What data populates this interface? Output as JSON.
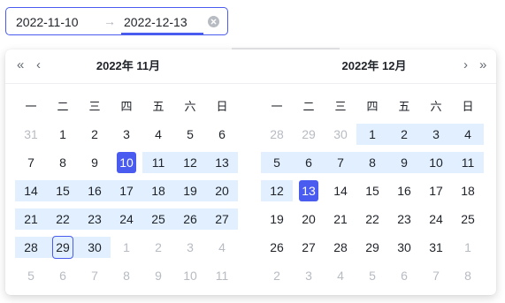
{
  "range_input": {
    "start": "2022-11-10",
    "separator": "→",
    "end": "2022-12-13"
  },
  "colors": {
    "accent": "#4a5cf0",
    "range": "#e1efff",
    "muted": "#b7bbc2"
  },
  "weekdays": [
    "一",
    "二",
    "三",
    "四",
    "五",
    "六",
    "日"
  ],
  "left_panel": {
    "title": "2022年  11月",
    "nav_prev_year": "«",
    "nav_prev_month": "‹",
    "days": [
      [
        "31",
        "1",
        "2",
        "3",
        "4",
        "5",
        "6"
      ],
      [
        "7",
        "8",
        "9",
        "10",
        "11",
        "12",
        "13"
      ],
      [
        "14",
        "15",
        "16",
        "17",
        "18",
        "19",
        "20"
      ],
      [
        "21",
        "22",
        "23",
        "24",
        "25",
        "26",
        "27"
      ],
      [
        "28",
        "29",
        "30",
        "1",
        "2",
        "3",
        "4"
      ],
      [
        "5",
        "6",
        "7",
        "8",
        "9",
        "10",
        "11"
      ]
    ]
  },
  "right_panel": {
    "title": "2022年  12月",
    "nav_next_month": "›",
    "nav_next_year": "»",
    "days": [
      [
        "28",
        "29",
        "30",
        "1",
        "2",
        "3",
        "4"
      ],
      [
        "5",
        "6",
        "7",
        "8",
        "9",
        "10",
        "11"
      ],
      [
        "12",
        "13",
        "14",
        "15",
        "16",
        "17",
        "18"
      ],
      [
        "19",
        "20",
        "21",
        "22",
        "23",
        "24",
        "25"
      ],
      [
        "26",
        "27",
        "28",
        "29",
        "30",
        "31",
        "1"
      ],
      [
        "2",
        "3",
        "4",
        "5",
        "6",
        "7",
        "8"
      ]
    ]
  }
}
